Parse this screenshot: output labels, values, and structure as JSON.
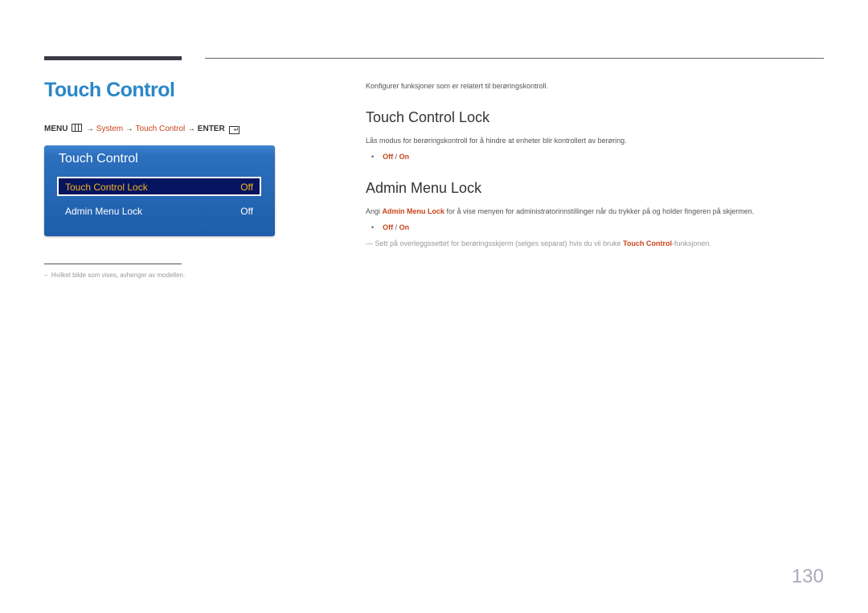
{
  "header": {
    "title": "Touch Control"
  },
  "menu_path": {
    "menu": "MENU",
    "arrow": "→",
    "system": "System",
    "touch_control": "Touch Control",
    "enter": "ENTER"
  },
  "osd": {
    "title": "Touch Control",
    "items": [
      {
        "label": "Touch Control Lock",
        "value": "Off",
        "selected": true
      },
      {
        "label": "Admin Menu Lock",
        "value": "Off",
        "selected": false
      }
    ]
  },
  "footnote": "Hvilket bilde som vises, avhenger av modellen.",
  "footnote_dash": "–",
  "intro": "Konfigurer funksjoner som er relatert til berøringskontroll.",
  "sections": [
    {
      "heading": "Touch Control Lock",
      "body": "Lås modus for berøringskontroll for å hindre at enheter blir kontrollert av berøring.",
      "option_off": "Off",
      "option_sep": " / ",
      "option_on": "On"
    },
    {
      "heading": "Admin Menu Lock",
      "body_prefix": "Angi ",
      "body_highlight": "Admin Menu Lock",
      "body_suffix": " for å vise menyen for administratorinnstillinger når du trykker på og holder fingeren på skjermen.",
      "option_off": "Off",
      "option_sep": " / ",
      "option_on": "On"
    }
  ],
  "note": {
    "dash": "―",
    "prefix": " Sett på overleggssettet for berøringsskjerm (selges separat) hvis du vil bruke ",
    "highlight": "Touch Control",
    "suffix": "-funksjonen."
  },
  "bullet_char": "•",
  "page_number": "130"
}
